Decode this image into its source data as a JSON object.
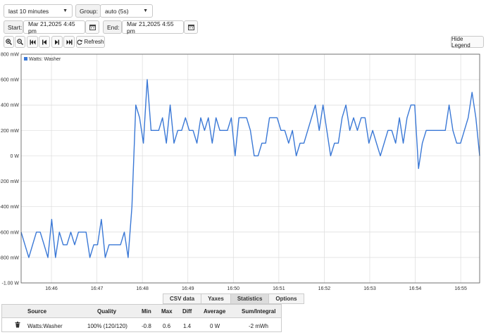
{
  "controls": {
    "range_select": "last 10 minutes",
    "group_label": "Group:",
    "group_select": "auto (5s)",
    "start_label": "Start:",
    "start_value": "Mar 21,2025 4:45 pm",
    "end_label": "End:",
    "end_value": "Mar 21,2025 4:55 pm",
    "refresh_label": "Refresh",
    "hide_legend_label": "Hide Legend"
  },
  "chart_data": {
    "type": "line",
    "legend": "Watts: Washer",
    "legend_position": "top-left",
    "y_unit": "W",
    "ylim": [
      -1.0,
      0.8
    ],
    "y_ticks": [
      {
        "v": 0.8,
        "label": "800 mW"
      },
      {
        "v": 0.6,
        "label": "600 mW"
      },
      {
        "v": 0.4,
        "label": "400 mW"
      },
      {
        "v": 0.2,
        "label": "200 mW"
      },
      {
        "v": 0.0,
        "label": "0 W"
      },
      {
        "v": -0.2,
        "label": "-200 mW"
      },
      {
        "v": -0.4,
        "label": "-400 mW"
      },
      {
        "v": -0.6,
        "label": "-600 mW"
      },
      {
        "v": -0.8,
        "label": "-800 mW"
      },
      {
        "v": -1.0,
        "label": "-1.00 W"
      }
    ],
    "x_unit": "seconds since 16:45",
    "xlim": [
      20,
      625
    ],
    "x_ticks": [
      {
        "v": 60,
        "label": "16:46"
      },
      {
        "v": 120,
        "label": "16:47"
      },
      {
        "v": 180,
        "label": "16:48"
      },
      {
        "v": 240,
        "label": "16:49"
      },
      {
        "v": 300,
        "label": "16:50"
      },
      {
        "v": 360,
        "label": "16:51"
      },
      {
        "v": 420,
        "label": "16:52"
      },
      {
        "v": 480,
        "label": "16:53"
      },
      {
        "v": 540,
        "label": "16:54"
      },
      {
        "v": 600,
        "label": "16:55"
      }
    ],
    "grid": true,
    "color": "#3a78d6",
    "series": [
      {
        "name": "Watts: Washer",
        "values": [
          -0.6,
          -0.7,
          -0.8,
          -0.7,
          -0.6,
          -0.6,
          -0.7,
          -0.8,
          -0.5,
          -0.8,
          -0.6,
          -0.7,
          -0.7,
          -0.6,
          -0.7,
          -0.6,
          -0.6,
          -0.6,
          -0.8,
          -0.7,
          -0.7,
          -0.5,
          -0.8,
          -0.7,
          -0.7,
          -0.7,
          -0.7,
          -0.6,
          -0.8,
          -0.4,
          0.4,
          0.3,
          0.1,
          0.6,
          0.2,
          0.2,
          0.2,
          0.3,
          0.1,
          0.4,
          0.1,
          0.2,
          0.2,
          0.3,
          0.2,
          0.2,
          0.1,
          0.3,
          0.2,
          0.3,
          0.1,
          0.3,
          0.2,
          0.2,
          0.2,
          0.3,
          0.0,
          0.3,
          0.3,
          0.3,
          0.2,
          0.0,
          0.0,
          0.1,
          0.1,
          0.3,
          0.3,
          0.3,
          0.2,
          0.2,
          0.1,
          0.2,
          0.0,
          0.1,
          0.1,
          0.2,
          0.3,
          0.4,
          0.2,
          0.4,
          0.2,
          0.0,
          0.1,
          0.1,
          0.3,
          0.4,
          0.2,
          0.3,
          0.2,
          0.3,
          0.3,
          0.1,
          0.2,
          0.1,
          0.0,
          0.1,
          0.2,
          0.2,
          0.1,
          0.3,
          0.1,
          0.3,
          0.4,
          0.4,
          -0.1,
          0.1,
          0.2,
          0.2,
          0.2,
          0.2,
          0.2,
          0.2,
          0.4,
          0.2,
          0.1,
          0.1,
          0.2,
          0.3,
          0.5,
          0.3,
          0.0
        ]
      }
    ]
  },
  "tabs": [
    "CSV data",
    "Yaxes",
    "Statistics",
    "Options"
  ],
  "stats": {
    "headers": {
      "source": "Source",
      "quality": "Quality",
      "min": "Min",
      "max": "Max",
      "diff": "Diff",
      "average": "Average",
      "sum": "Sum/Integral"
    },
    "row": {
      "source": "Watts:Washer",
      "quality": "100% (120/120)",
      "min": "-0.8",
      "max": "0.6",
      "diff": "1.4",
      "average": "0 W",
      "sum": "-2 mWh"
    }
  }
}
